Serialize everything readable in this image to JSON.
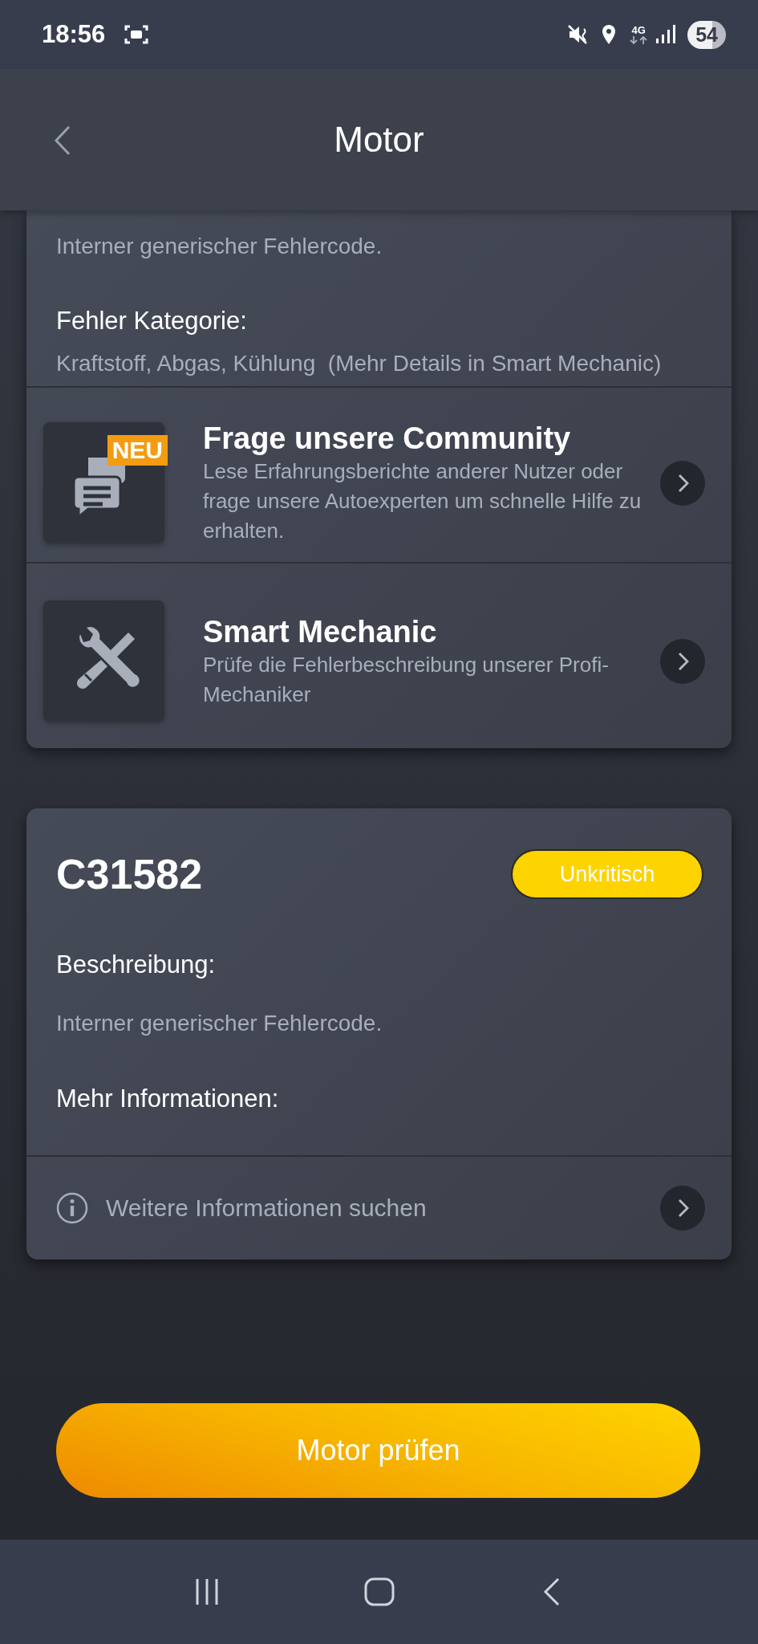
{
  "status_bar": {
    "time": "18:56",
    "network": "4G",
    "battery": "54"
  },
  "header": {
    "title": "Motor"
  },
  "fault_card": {
    "description": "Interner generischer Fehlercode.",
    "category_label": "Fehler Kategorie:",
    "category": "Kraftstoff, Abgas, Kühlung  (Mehr Details in Smart Mechanic)",
    "links": [
      {
        "kind": "community",
        "title": "Frage unsere Community",
        "badge": "NEU",
        "text": "Lese Erfahrungsberichte anderer Nutzer oder frage unsere Autoexperten um schnelle Hilfe zu erhalten."
      },
      {
        "kind": "mechanic",
        "title": "Smart Mechanic",
        "text": "Prüfe die Fehlerbeschreibung unserer Profi-Mechaniker"
      }
    ]
  },
  "code_card": {
    "code": "C31582",
    "severity": "Unkritisch",
    "description_label": "Beschreibung:",
    "description": "Interner generischer Fehlercode.",
    "more_label": "Mehr Informationen:",
    "search_link": "Weitere Informationen suchen"
  },
  "primary_button": "Motor prüfen"
}
